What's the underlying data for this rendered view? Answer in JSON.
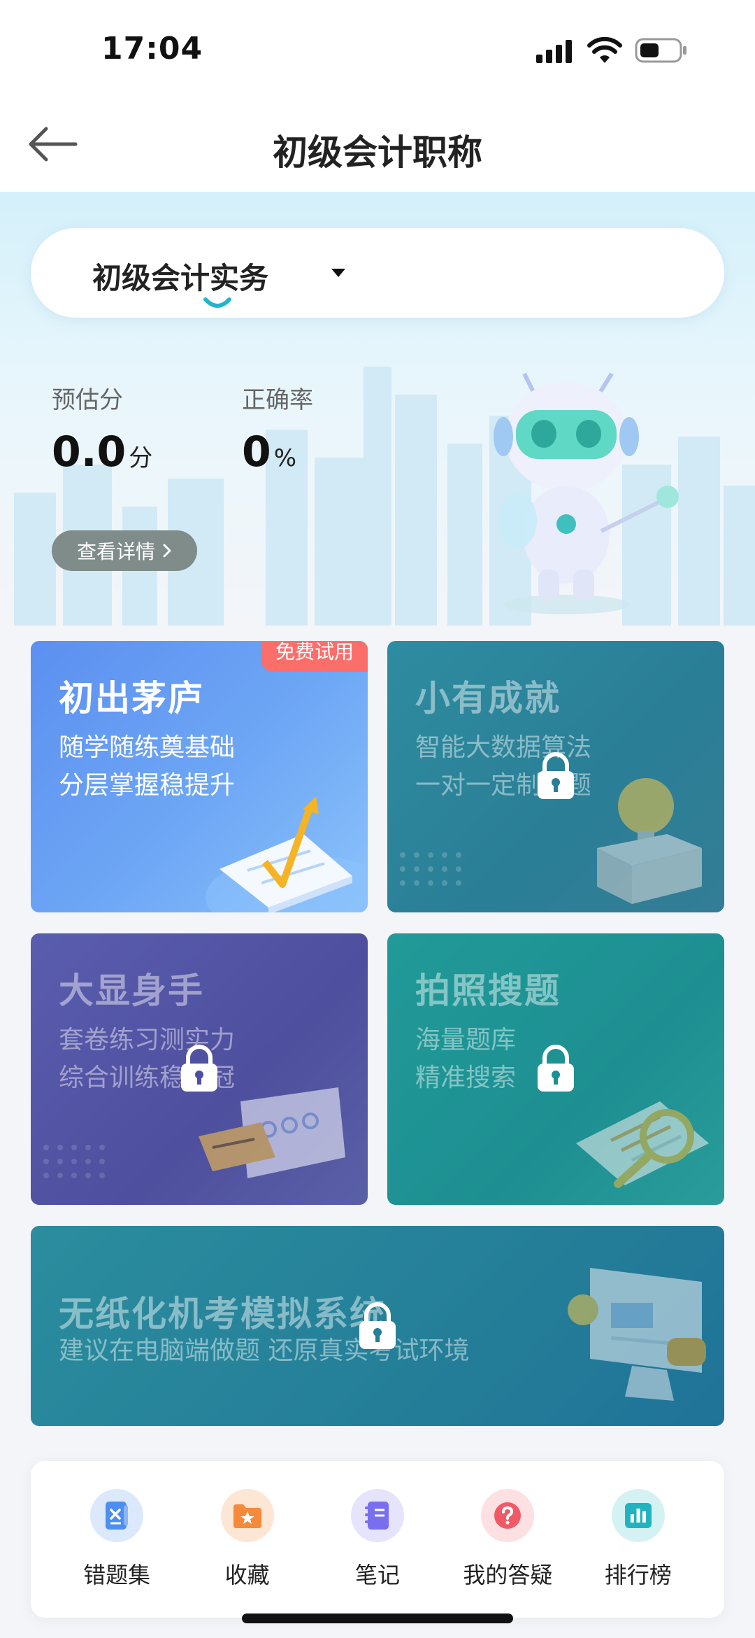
{
  "status_bar": {
    "time": "17:04"
  },
  "nav": {
    "title": "初级会计职称"
  },
  "subject": {
    "selected": "初级会计实务"
  },
  "stats": {
    "estimate_label": "预估分",
    "estimate_value": "0.0",
    "estimate_unit": "分",
    "accuracy_label": "正确率",
    "accuracy_value": "0",
    "accuracy_unit": "%"
  },
  "detail_button": {
    "label": "查看详情"
  },
  "cards": [
    {
      "title": "初出茅庐",
      "desc1": "随学随练奠基础",
      "desc2": "分层掌握稳提升",
      "badge": "免费试用",
      "locked": false
    },
    {
      "title": "小有成就",
      "desc1": "智能大数据算法",
      "desc2": "一对一定制难题",
      "locked": true
    },
    {
      "title": "大显身手",
      "desc1": "套卷练习测实力",
      "desc2": "综合训练稳夺冠",
      "locked": true
    },
    {
      "title": "拍照搜题",
      "desc1": "海量题库",
      "desc2": "精准搜索",
      "locked": true
    },
    {
      "title": "无纸化机考模拟系统",
      "desc1": "建议在电脑端做题  还原真实考试环境",
      "locked": true
    }
  ],
  "tools": [
    {
      "label": "错题集",
      "icon": "wrong-questions-icon",
      "color": "#4d8ff0",
      "bg": "#dce9fd"
    },
    {
      "label": "收藏",
      "icon": "favorites-icon",
      "color": "#f58a3a",
      "bg": "#fde6d4"
    },
    {
      "label": "笔记",
      "icon": "notes-icon",
      "color": "#7a6ef0",
      "bg": "#e6e3fd"
    },
    {
      "label": "我的答疑",
      "icon": "question-icon",
      "color": "#f05a66",
      "bg": "#fde0e2"
    },
    {
      "label": "排行榜",
      "icon": "ranking-icon",
      "color": "#23b3c0",
      "bg": "#d4f2f4"
    }
  ]
}
